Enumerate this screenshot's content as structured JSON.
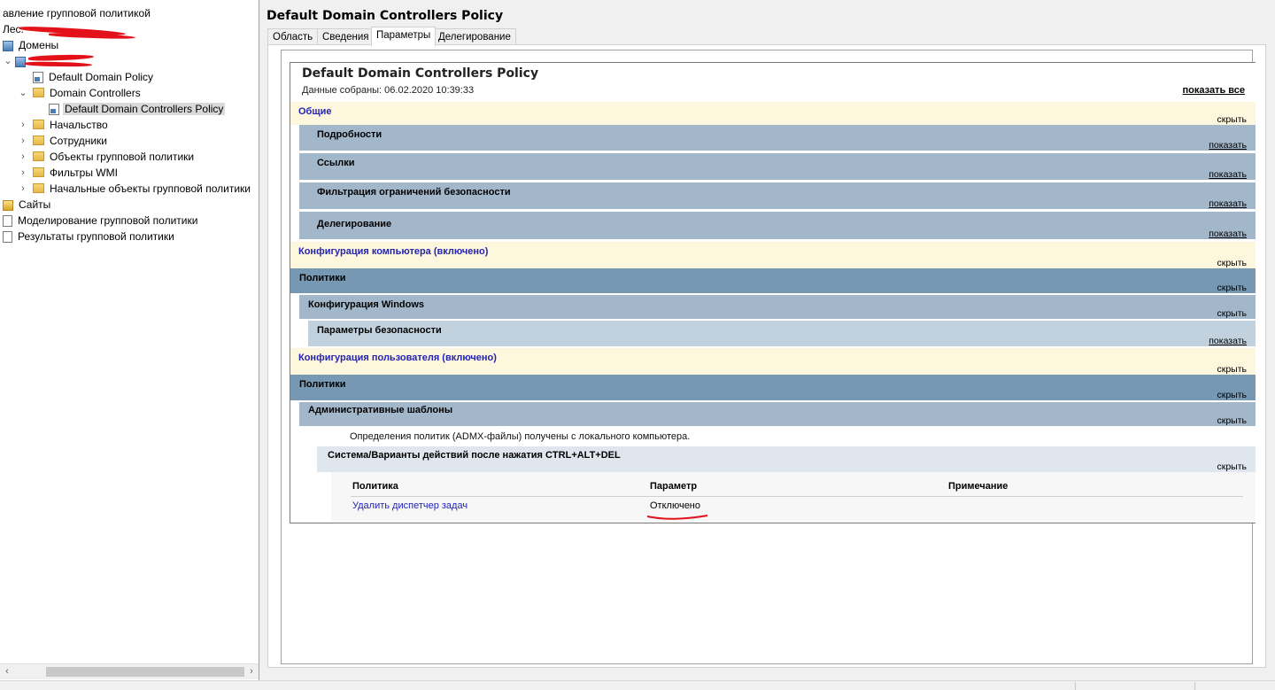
{
  "tree": {
    "header_text": "авление групповой политикой",
    "forest_label": "Лес:",
    "items": [
      {
        "label": "Домены"
      },
      {
        "label": ""
      },
      {
        "label": "Default Domain Policy"
      },
      {
        "label": "Domain Controllers"
      },
      {
        "label": "Default Domain Controllers Policy"
      },
      {
        "label": "Начальство"
      },
      {
        "label": "Сотрудники"
      },
      {
        "label": "Объекты групповой политики"
      },
      {
        "label": "Фильтры WMI"
      },
      {
        "label": "Начальные объекты групповой политики"
      },
      {
        "label": "Сайты"
      },
      {
        "label": "Моделирование групповой политики"
      },
      {
        "label": "Результаты групповой политики"
      }
    ]
  },
  "right": {
    "title": "Default Domain Controllers Policy",
    "tabs": [
      "Область",
      "Сведения",
      "Параметры",
      "Делегирование"
    ],
    "active_tab": "Параметры"
  },
  "report": {
    "title": "Default Domain Controllers Policy",
    "collected": "Данные собраны: 06.02.2020 10:39:33",
    "show_all": "показать все",
    "sections": {
      "general": {
        "title": "Общие",
        "action": "скрыть"
      },
      "details": {
        "title": "Подробности",
        "action": "показать"
      },
      "links": {
        "title": "Ссылки",
        "action": "показать"
      },
      "security_filtering": {
        "title": "Фильтрация ограничений безопасности",
        "action": "показать"
      },
      "delegation": {
        "title": "Делегирование",
        "action": "показать"
      },
      "computer_config": {
        "title": "Конфигурация компьютера (включено)",
        "action": "скрыть"
      },
      "comp_policies": {
        "title": "Политики",
        "action": "скрыть"
      },
      "windows_config": {
        "title": "Конфигурация Windows",
        "action": "скрыть"
      },
      "security_settings": {
        "title": "Параметры безопасности",
        "action": "показать"
      },
      "user_config": {
        "title": "Конфигурация пользователя (включено)",
        "action": "скрыть"
      },
      "user_policies": {
        "title": "Политики",
        "action": "скрыть"
      },
      "admin_templates": {
        "title": "Административные шаблоны",
        "action": "скрыть"
      },
      "cad_options": {
        "title": "Система/Варианты действий после нажатия CTRL+ALT+DEL",
        "action": "скрыть"
      }
    },
    "admx_note": "Определения политик (ADMX-файлы) получены с локального компьютера.",
    "table": {
      "headers": [
        "Политика",
        "Параметр",
        "Примечание"
      ],
      "rows": [
        {
          "policy": "Удалить диспетчер задач",
          "setting": "Отключено",
          "comment": ""
        }
      ]
    }
  },
  "colors": {
    "redaction": "#e3111a",
    "link": "#2323b4",
    "level0_bg": "#fdf7dd",
    "level1_bg": "#a3b7cb",
    "policies_bg": "#7698b2"
  }
}
